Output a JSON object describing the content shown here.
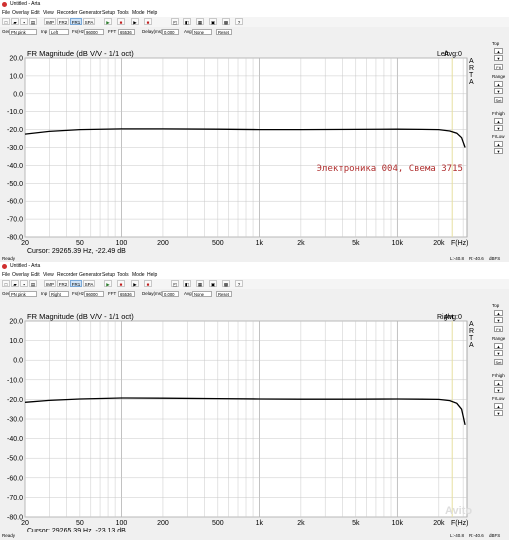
{
  "windows": [
    {
      "title": "Untitled - Arta",
      "menu": [
        "File",
        "Overlay",
        "Edit",
        "View",
        "Recorder",
        "Generator",
        "Setup",
        "Tools",
        "Mode",
        "Help"
      ],
      "toolbar": [
        "IMP",
        "FR2",
        "FR1",
        "SPA"
      ],
      "toolbar_selected": "FR1",
      "params": {
        "gen_label": "Gen",
        "gen_value": "PN pink",
        "inp_label": "Inp",
        "inp_value": "Left",
        "fs_label": "Fs(Hz)",
        "fs_value": "96000",
        "fft_label": "FFT",
        "fft_value": "65536",
        "delay_label": "Delay(ms)",
        "delay_value": "0.000",
        "avg_label": "Avg",
        "avg_value": "None",
        "reset_label": "Reset"
      },
      "chart_title": "FR Magnitude (dB V/V - 1/1 oct)",
      "channel": "Left",
      "avg": "Avg:0",
      "arta": [
        "A",
        "R",
        "T",
        "A"
      ],
      "annotation": "Электроника 004, Свема 3715",
      "cursor": "Cursor: 29265.39 Hz, -22.49 dB",
      "status": {
        "left": "Ready",
        "r1": "L:-40.8",
        "r2": "R:-40.6",
        "r3": "dBFS"
      }
    },
    {
      "title": "Untitled - Arta",
      "menu": [
        "File",
        "Overlay",
        "Edit",
        "View",
        "Recorder",
        "Generator",
        "Setup",
        "Tools",
        "Mode",
        "Help"
      ],
      "toolbar": [
        "IMP",
        "FR2",
        "FR1",
        "SPA"
      ],
      "toolbar_selected": "FR1",
      "params": {
        "gen_label": "Gen",
        "gen_value": "PN pink",
        "inp_label": "Inp",
        "inp_value": "Right",
        "fs_label": "Fs(Hz)",
        "fs_value": "96000",
        "fft_label": "FFT",
        "fft_value": "65536",
        "delay_label": "Delay(ms)",
        "delay_value": "0.000",
        "avg_label": "Avg",
        "avg_value": "None",
        "reset_label": "Reset"
      },
      "chart_title": "FR Magnitude (dB V/V - 1/1 oct)",
      "channel": "Right",
      "avg": "Avg:0",
      "arta": [
        "A",
        "R",
        "T",
        "A"
      ],
      "annotation": "",
      "cursor": "Cursor: 29265.39 Hz, -23.13 dB",
      "status": {
        "left": "Ready",
        "r1": "L:-40.8",
        "r2": "R:-40.6",
        "r3": "dBFS"
      }
    }
  ],
  "sidebar": {
    "top_label": "Top",
    "fit_label": "Fit",
    "range_label": "Range",
    "set_label": "Set",
    "frhigh_label": "Frhigh",
    "frlow_label": "FrLow",
    "up": "▲",
    "down": "▼"
  },
  "watermark": "Avito",
  "colors": {
    "trace": "#000000",
    "grid": "#c8c8c8",
    "plot_bg": "#ffffff",
    "marker": "#e6e0a0",
    "annotation": "#b03030"
  },
  "chart_data": [
    {
      "type": "line",
      "title": "FR Magnitude (dB V/V - 1/1 oct)",
      "xlabel": "F(Hz)",
      "ylabel": "",
      "xscale": "log",
      "xlim": [
        20,
        32000
      ],
      "ylim": [
        -80,
        20
      ],
      "xticks": [
        20,
        50,
        100,
        200,
        500,
        1000,
        2000,
        5000,
        10000,
        20000
      ],
      "xtick_labels": [
        "20",
        "50",
        "100",
        "200",
        "500",
        "1k",
        "2k",
        "5k",
        "10k",
        "20k"
      ],
      "yticks": [
        20,
        10,
        0,
        -10,
        -20,
        -30,
        -40,
        -50,
        -60,
        -70,
        -80
      ],
      "ytick_labels": [
        "20.0",
        "10.0",
        "0.0",
        "-10.0",
        "-20.0",
        "-30.0",
        "-40.0",
        "-50.0",
        "-60.0",
        "-70.0",
        "-80.0"
      ],
      "marker_freq": 25000,
      "series": [
        {
          "x": [
            20,
            30,
            50,
            100,
            200,
            500,
            1000,
            2000,
            5000,
            10000,
            15000,
            20000,
            24000,
            27000,
            29265,
            31000
          ],
          "y": [
            -22.5,
            -21.0,
            -20.0,
            -19.6,
            -19.6,
            -19.8,
            -20.0,
            -20.0,
            -19.9,
            -19.8,
            -19.9,
            -20.0,
            -20.8,
            -22.0,
            -24.5,
            -30.0
          ]
        }
      ]
    },
    {
      "type": "line",
      "title": "FR Magnitude (dB V/V - 1/1 oct)",
      "xlabel": "F(Hz)",
      "ylabel": "",
      "xscale": "log",
      "xlim": [
        20,
        32000
      ],
      "ylim": [
        -80,
        20
      ],
      "xticks": [
        20,
        50,
        100,
        200,
        500,
        1000,
        2000,
        5000,
        10000,
        20000
      ],
      "xtick_labels": [
        "20",
        "50",
        "100",
        "200",
        "500",
        "1k",
        "2k",
        "5k",
        "10k",
        "20k"
      ],
      "yticks": [
        20,
        10,
        0,
        -10,
        -20,
        -30,
        -40,
        -50,
        -60,
        -70,
        -80
      ],
      "ytick_labels": [
        "20.0",
        "10.0",
        "0.0",
        "-10.0",
        "-20.0",
        "-30.0",
        "-40.0",
        "-50.0",
        "-60.0",
        "-70.0",
        "-80.0"
      ],
      "marker_freq": 25000,
      "series": [
        {
          "x": [
            20,
            30,
            50,
            100,
            200,
            500,
            1000,
            2000,
            5000,
            10000,
            15000,
            20000,
            24000,
            27000,
            29265,
            31000
          ],
          "y": [
            -21.5,
            -20.5,
            -19.8,
            -19.3,
            -19.4,
            -19.6,
            -19.8,
            -19.9,
            -19.9,
            -19.8,
            -19.9,
            -20.0,
            -20.6,
            -22.0,
            -25.0,
            -33.0
          ]
        }
      ]
    }
  ]
}
